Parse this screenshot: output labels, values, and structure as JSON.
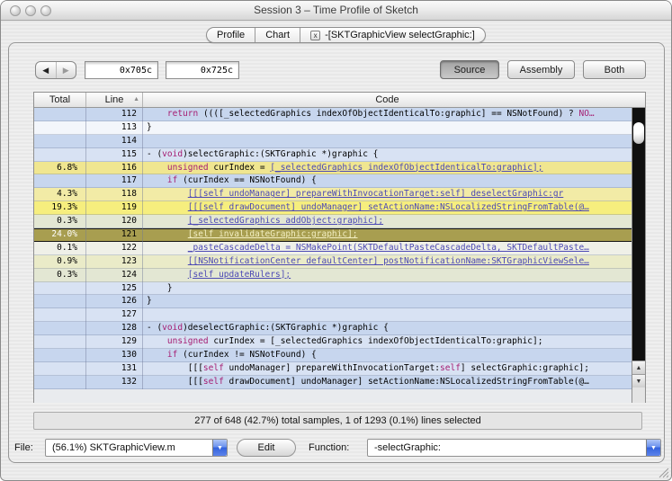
{
  "window": {
    "title": "Session 3 – Time Profile of Sketch"
  },
  "tabs": [
    {
      "label": "Profile"
    },
    {
      "label": "Chart"
    },
    {
      "label": "-[SKTGraphicView selectGraphic:]",
      "close_icon": "x"
    }
  ],
  "toolbar": {
    "back_icon": "◀",
    "forward_icon": "▶",
    "address_start": "0x705c",
    "address_end": "0x725c",
    "view_buttons": [
      {
        "label": "Source",
        "active": true
      },
      {
        "label": "Assembly",
        "active": false
      },
      {
        "label": "Both",
        "active": false
      }
    ]
  },
  "table": {
    "headers": {
      "total": "Total",
      "line": "Line",
      "code": "Code",
      "sort_icon": "▲"
    },
    "rows": [
      {
        "pct": "",
        "num": "112",
        "bg": "blue",
        "sel": false,
        "code": [
          [
            "p",
            "    "
          ],
          [
            "k",
            "return"
          ],
          [
            "p",
            " ((([_selectedGraphics indexOfObjectIdenticalTo:graphic] == NSNotFound) ? "
          ],
          [
            "k",
            "NO…"
          ]
        ]
      },
      {
        "pct": "",
        "num": "113",
        "bg": "white",
        "sel": false,
        "code": [
          [
            "p",
            "}"
          ]
        ]
      },
      {
        "pct": "",
        "num": "114",
        "bg": "blue",
        "sel": false,
        "code": []
      },
      {
        "pct": "",
        "num": "115",
        "bg": "blue2",
        "sel": false,
        "code": [
          [
            "p",
            "- ("
          ],
          [
            "k",
            "void"
          ],
          [
            "p",
            ")selectGraphic:(SKTGraphic *)graphic {"
          ]
        ]
      },
      {
        "pct": "6.8%",
        "num": "116",
        "bg": "y4",
        "sel": false,
        "code": [
          [
            "p",
            "    "
          ],
          [
            "k",
            "unsigned"
          ],
          [
            "p",
            " curIndex = "
          ],
          [
            "l",
            "[_selectedGraphics indexOfObjectIdenticalTo:graphic];"
          ]
        ]
      },
      {
        "pct": "",
        "num": "117",
        "bg": "blue",
        "sel": false,
        "code": [
          [
            "p",
            "    "
          ],
          [
            "k",
            "if"
          ],
          [
            "p",
            " (curIndex == NSNotFound) {"
          ]
        ]
      },
      {
        "pct": "4.3%",
        "num": "118",
        "bg": "y3",
        "sel": false,
        "code": [
          [
            "p",
            "        "
          ],
          [
            "l",
            "[[[self undoManager] prepareWithInvocationTarget:self] deselectGraphic:gr"
          ]
        ]
      },
      {
        "pct": "19.3%",
        "num": "119",
        "bg": "y5",
        "sel": false,
        "code": [
          [
            "p",
            "        "
          ],
          [
            "l",
            "[[[self drawDocument] undoManager] setActionName:NSLocalizedStringFromTable(@…"
          ]
        ]
      },
      {
        "pct": "0.3%",
        "num": "120",
        "bg": "y1",
        "sel": false,
        "code": [
          [
            "p",
            "        "
          ],
          [
            "l",
            "[_selectedGraphics addObject:graphic];"
          ]
        ]
      },
      {
        "pct": "24.0%",
        "num": "121",
        "bg": "sel",
        "sel": true,
        "code": [
          [
            "p",
            "        "
          ],
          [
            "l",
            "[self invalidateGraphic:graphic];"
          ]
        ]
      },
      {
        "pct": "0.1%",
        "num": "122",
        "bg": "y0",
        "sel": false,
        "code": [
          [
            "p",
            "        "
          ],
          [
            "l",
            "_pasteCascadeDelta = NSMakePoint(SKTDefaultPasteCascadeDelta, SKTDefaultPaste…"
          ]
        ]
      },
      {
        "pct": "0.9%",
        "num": "123",
        "bg": "y2",
        "sel": false,
        "code": [
          [
            "p",
            "        "
          ],
          [
            "l",
            "[[NSNotificationCenter defaultCenter] postNotificationName:SKTGraphicViewSele…"
          ]
        ]
      },
      {
        "pct": "0.3%",
        "num": "124",
        "bg": "y1",
        "sel": false,
        "code": [
          [
            "p",
            "        "
          ],
          [
            "l",
            "[self updateRulers];"
          ]
        ]
      },
      {
        "pct": "",
        "num": "125",
        "bg": "blue2",
        "sel": false,
        "code": [
          [
            "p",
            "    }"
          ]
        ]
      },
      {
        "pct": "",
        "num": "126",
        "bg": "blue",
        "sel": false,
        "code": [
          [
            "p",
            "}"
          ]
        ]
      },
      {
        "pct": "",
        "num": "127",
        "bg": "blue2",
        "sel": false,
        "code": []
      },
      {
        "pct": "",
        "num": "128",
        "bg": "blue",
        "sel": false,
        "code": [
          [
            "p",
            "- ("
          ],
          [
            "k",
            "void"
          ],
          [
            "p",
            ")deselectGraphic:(SKTGraphic *)graphic {"
          ]
        ]
      },
      {
        "pct": "",
        "num": "129",
        "bg": "blue2",
        "sel": false,
        "code": [
          [
            "p",
            "    "
          ],
          [
            "k",
            "unsigned"
          ],
          [
            "p",
            " curIndex = [_selectedGraphics indexOfObjectIdenticalTo:graphic];"
          ]
        ]
      },
      {
        "pct": "",
        "num": "130",
        "bg": "blue",
        "sel": false,
        "code": [
          [
            "p",
            "    "
          ],
          [
            "k",
            "if"
          ],
          [
            "p",
            " (curIndex != NSNotFound) {"
          ]
        ]
      },
      {
        "pct": "",
        "num": "131",
        "bg": "blue2",
        "sel": false,
        "code": [
          [
            "p",
            "        [[["
          ],
          [
            "k",
            "self"
          ],
          [
            "p",
            " undoManager] prepareWithInvocationTarget:"
          ],
          [
            "k",
            "self"
          ],
          [
            "p",
            "] selectGraphic:graphic];"
          ]
        ]
      },
      {
        "pct": "",
        "num": "132",
        "bg": "blue",
        "sel": false,
        "code": [
          [
            "p",
            "        [[["
          ],
          [
            "k",
            "self"
          ],
          [
            "p",
            " drawDocument] undoManager] setActionName:NSLocalizedStringFromTable(@…"
          ]
        ]
      }
    ]
  },
  "scrollbar": {
    "up_icon": "▲",
    "down_icon": "▼"
  },
  "status": {
    "text": "277 of 648 (42.7%) total samples, 1 of 1293 (0.1%) lines selected"
  },
  "footer": {
    "file_label": "File:",
    "file_value": "(56.1%) SKTGraphicView.m",
    "edit_label": "Edit",
    "function_label": "Function:",
    "function_value": "-selectGraphic:",
    "popup_arrow_icon": "▼"
  },
  "colors": {
    "accent_blue_row": "#c7d6ee",
    "sample_yellow": "#f6ee7e",
    "selected_olive": "#a89e50",
    "link": "#4c49b5",
    "keyword": "#a51d72"
  }
}
